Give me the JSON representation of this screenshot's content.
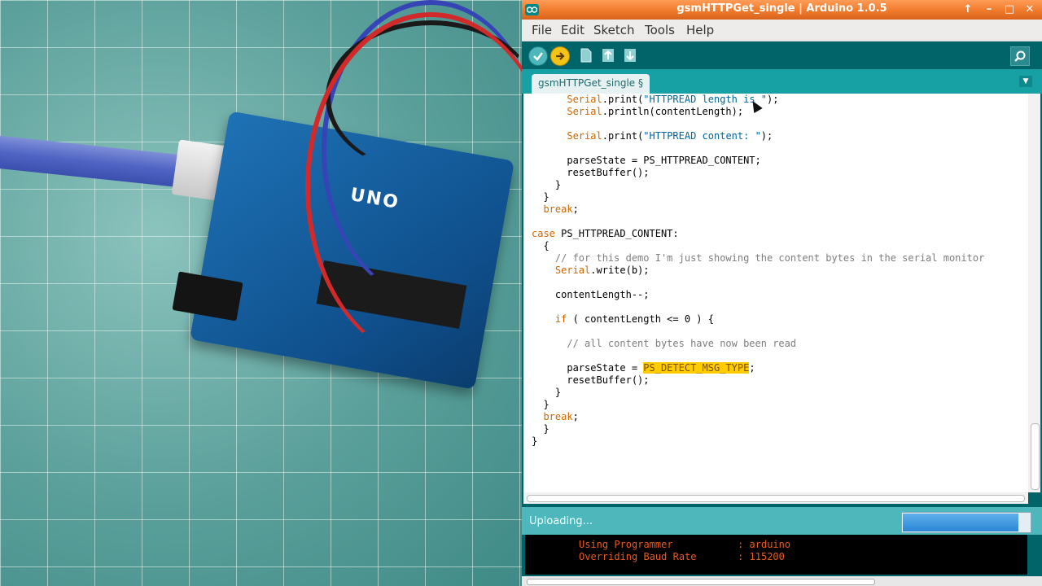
{
  "window": {
    "title": "gsmHTTPGet_single | Arduino 1.0.5",
    "buttons": [
      "↑",
      "–",
      "□",
      "✕"
    ]
  },
  "menu": [
    "File",
    "Edit",
    "Sketch",
    "Tools",
    "Help"
  ],
  "toolbar": {
    "icons": [
      "verify-icon",
      "upload-icon",
      "new-icon",
      "open-icon",
      "save-icon",
      "serial-monitor-icon"
    ]
  },
  "tab": {
    "label": "gsmHTTPGet_single §"
  },
  "code": {
    "lines": [
      "      Serial.print(\"HTTPREAD length is \");",
      "      Serial.println(contentLength);",
      "",
      "      Serial.print(\"HTTPREAD content: \");",
      "",
      "      parseState = PS_HTTPREAD_CONTENT;",
      "      resetBuffer();",
      "    }",
      "  }",
      "  break;",
      "",
      "case PS_HTTPREAD_CONTENT:",
      "  {",
      "    // for this demo I'm just showing the content bytes in the serial monitor",
      "    Serial.write(b);",
      "",
      "    contentLength--;",
      "",
      "    if ( contentLength <= 0 ) {",
      "",
      "      // all content bytes have now been read",
      "",
      "      parseState = PS_DETECT_MSG_TYPE;",
      "      resetBuffer();",
      "    }",
      "  }",
      "  break;",
      "  }",
      "}"
    ],
    "highlighted_token": "PS_DETECT_MSG_TYPE"
  },
  "status": {
    "text": "Uploading...",
    "progress": 0.91,
    "progress_color": "#2a86d6"
  },
  "console": {
    "lines": [
      "Using Programmer           : arduino",
      "Overriding Baud Rate       : 115200"
    ],
    "text_color": "#e85a1a"
  },
  "photo": {
    "board_label": "UNO"
  },
  "colors": {
    "ide_bg": "#006468",
    "title_bar": "#f07a2b",
    "tab_bar": "#17a1a5",
    "highlight": "#ffcc00"
  }
}
